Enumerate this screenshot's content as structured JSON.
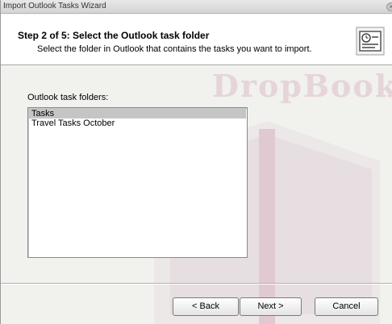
{
  "window": {
    "title": "Import Outlook Tasks Wizard"
  },
  "header": {
    "step_title": "Step 2 of 5: Select the Outlook task folder",
    "instruction": "Select the folder in Outlook that contains the tasks you want to import."
  },
  "folders": {
    "label": "Outlook task folders:",
    "items": [
      {
        "label": "Tasks",
        "selected": true
      },
      {
        "label": "Travel Tasks October",
        "selected": false
      }
    ]
  },
  "buttons": {
    "back": "< Back",
    "next": "Next >",
    "cancel": "Cancel"
  },
  "watermark": {
    "text": "DropBook"
  },
  "colors": {
    "selection": "#c5c5c5",
    "dialog_background": "#f1f1ee",
    "header_background": "#ffffff"
  }
}
